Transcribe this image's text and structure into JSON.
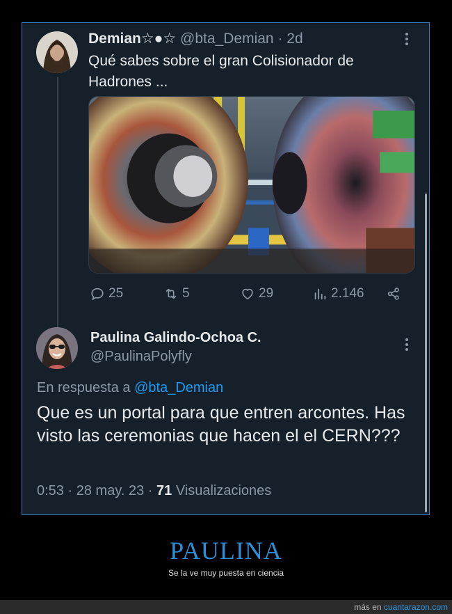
{
  "tweet1": {
    "display_name": "Demian☆●☆",
    "handle": "@bta_Demian",
    "separator": "·",
    "age": "2d",
    "text": "Qué sabes sobre el gran Colisionador de Hadrones ...",
    "actions": {
      "replies": "25",
      "retweets": "5",
      "likes": "29",
      "views": "2.146"
    }
  },
  "tweet2": {
    "display_name": "Paulina Galindo-Ochoa C.",
    "handle": "@PaulinaPolyfly",
    "reply_prefix": "En respuesta a",
    "reply_handle": "@bta_Demian",
    "text": "Que es un portal para que entren arcontes. Has visto las ceremonias que hacen el el CERN???",
    "time": "0:53",
    "date": "28 may. 23",
    "views_count": "71",
    "views_label": "Visualizaciones"
  },
  "caption": {
    "title": "PAULINA",
    "subtitle": "Se la ve muy puesta en ciencia"
  },
  "footer": {
    "prefix": "más en",
    "site": "cuantarazon.com"
  },
  "colors": {
    "background": "#15202b",
    "link": "#1d9bf0",
    "muted": "#8b98a5",
    "caption_title": "#2f8fd6"
  }
}
